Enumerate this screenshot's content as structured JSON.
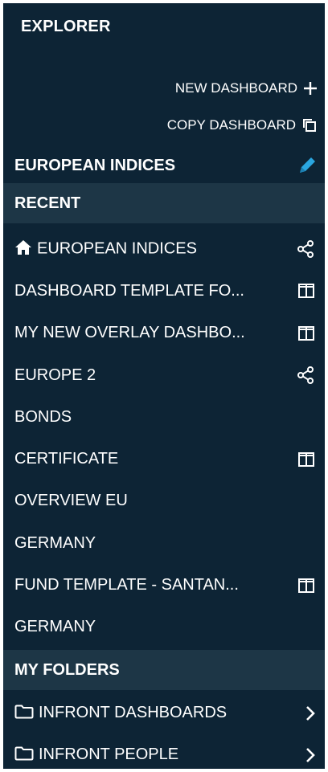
{
  "explorer": {
    "title": "EXPLORER",
    "new_dashboard_label": "NEW DASHBOARD",
    "copy_dashboard_label": "COPY DASHBOARD",
    "current_dashboard": "EUROPEAN INDICES"
  },
  "recent": {
    "header": "RECENT",
    "items": [
      {
        "label": "EUROPEAN INDICES",
        "lead_icon": "home-icon",
        "trail_icon": "share-icon"
      },
      {
        "label": "DASHBOARD TEMPLATE FO...",
        "trail_icon": "columns-icon"
      },
      {
        "label": "MY NEW OVERLAY DASHBO...",
        "trail_icon": "columns-icon"
      },
      {
        "label": "EUROPE 2",
        "trail_icon": "share-icon"
      },
      {
        "label": "BONDS"
      },
      {
        "label": "CERTIFICATE",
        "trail_icon": "columns-icon"
      },
      {
        "label": "OVERVIEW EU"
      },
      {
        "label": "GERMANY"
      },
      {
        "label": "FUND TEMPLATE - SANTAN...",
        "trail_icon": "columns-icon"
      },
      {
        "label": "GERMANY"
      }
    ]
  },
  "folders": {
    "header": "MY FOLDERS",
    "items": [
      {
        "label": "INFRONT DASHBOARDS"
      },
      {
        "label": "INFRONT PEOPLE"
      }
    ]
  },
  "colors": {
    "panel_bg": "#0d2435",
    "section_bg": "#1d3646",
    "accent": "#2aa6e0"
  }
}
